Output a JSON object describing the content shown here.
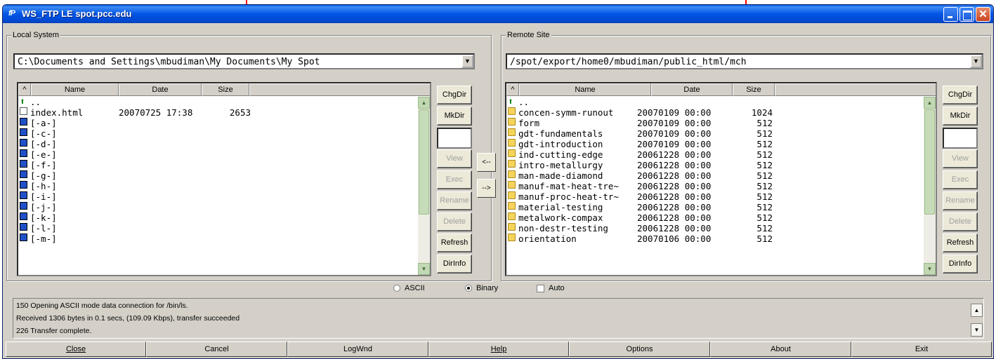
{
  "window": {
    "app_icon": "fP",
    "title": "WS_FTP LE spot.pcc.edu"
  },
  "local": {
    "group_label": "Local System",
    "path": "C:\\Documents and Settings\\mbudiman\\My Documents\\My Spot",
    "columns": [
      "^",
      "Name",
      "Date",
      "Size"
    ],
    "rows": [
      {
        "icon": "up-arrow-icon",
        "name": "..",
        "date": "",
        "size": ""
      },
      {
        "icon": "file-icon",
        "name": "index.html",
        "date": "20070725 17:38",
        "size": "2653"
      },
      {
        "icon": "drive-icon",
        "name": "[-a-]",
        "date": "",
        "size": ""
      },
      {
        "icon": "drive-icon",
        "name": "[-c-]",
        "date": "",
        "size": ""
      },
      {
        "icon": "drive-icon",
        "name": "[-d-]",
        "date": "",
        "size": ""
      },
      {
        "icon": "drive-icon",
        "name": "[-e-]",
        "date": "",
        "size": ""
      },
      {
        "icon": "drive-icon",
        "name": "[-f-]",
        "date": "",
        "size": ""
      },
      {
        "icon": "drive-icon",
        "name": "[-g-]",
        "date": "",
        "size": ""
      },
      {
        "icon": "drive-icon",
        "name": "[-h-]",
        "date": "",
        "size": ""
      },
      {
        "icon": "drive-icon",
        "name": "[-i-]",
        "date": "",
        "size": ""
      },
      {
        "icon": "drive-icon",
        "name": "[-j-]",
        "date": "",
        "size": ""
      },
      {
        "icon": "drive-icon",
        "name": "[-k-]",
        "date": "",
        "size": ""
      },
      {
        "icon": "drive-icon",
        "name": "[-l-]",
        "date": "",
        "size": ""
      },
      {
        "icon": "drive-icon",
        "name": "[-m-]",
        "date": "",
        "size": ""
      }
    ],
    "buttons": {
      "chgdir": "ChgDir",
      "mkdir": "MkDir",
      "view": "View",
      "exec": "Exec",
      "rename": "Rename",
      "delete": "Delete",
      "refresh": "Refresh",
      "dirinfo": "DirInfo"
    }
  },
  "remote": {
    "group_label": "Remote Site",
    "path": "/spot/export/home0/mbudiman/public_html/mch",
    "columns": [
      "^",
      "Name",
      "Date",
      "Size"
    ],
    "rows": [
      {
        "icon": "up-arrow-icon",
        "name": "..",
        "date": "",
        "size": ""
      },
      {
        "icon": "folder-icon",
        "name": "concen-symm-runout",
        "date": "20070109 00:00",
        "size": "1024"
      },
      {
        "icon": "folder-icon",
        "name": "form",
        "date": "20070109 00:00",
        "size": "512"
      },
      {
        "icon": "folder-icon",
        "name": "gdt-fundamentals",
        "date": "20070109 00:00",
        "size": "512"
      },
      {
        "icon": "folder-icon",
        "name": "gdt-introduction",
        "date": "20070109 00:00",
        "size": "512"
      },
      {
        "icon": "folder-icon",
        "name": "ind-cutting-edge",
        "date": "20061228 00:00",
        "size": "512"
      },
      {
        "icon": "folder-icon",
        "name": "intro-metallurgy",
        "date": "20061228 00:00",
        "size": "512"
      },
      {
        "icon": "folder-icon",
        "name": "man-made-diamond",
        "date": "20061228 00:00",
        "size": "512"
      },
      {
        "icon": "folder-icon",
        "name": "manuf-mat-heat-tre~",
        "date": "20061228 00:00",
        "size": "512"
      },
      {
        "icon": "folder-icon",
        "name": "manuf-proc-heat-tr~",
        "date": "20061228 00:00",
        "size": "512"
      },
      {
        "icon": "folder-icon",
        "name": "material-testing",
        "date": "20061228 00:00",
        "size": "512"
      },
      {
        "icon": "folder-icon",
        "name": "metalwork-compax",
        "date": "20061228 00:00",
        "size": "512"
      },
      {
        "icon": "folder-icon",
        "name": "non-destr-testing",
        "date": "20061228 00:00",
        "size": "512"
      },
      {
        "icon": "folder-icon",
        "name": "orientation",
        "date": "20070106 00:00",
        "size": "512"
      }
    ],
    "buttons": {
      "chgdir": "ChgDir",
      "mkdir": "MkDir",
      "view": "View",
      "exec": "Exec",
      "rename": "Rename",
      "delete": "Delete",
      "refresh": "Refresh",
      "dirinfo": "DirInfo"
    }
  },
  "transfer": {
    "upload": "<--",
    "download": "-->"
  },
  "mode": {
    "ascii": "ASCII",
    "binary": "Binary",
    "auto": "Auto",
    "selected": "Binary"
  },
  "log": [
    "150 Opening ASCII mode data connection for /bin/ls.",
    "Received 1306 bytes in 0.1 secs, (109.09 Kbps), transfer succeeded",
    "226 Transfer complete."
  ],
  "bottom_buttons": [
    {
      "key": "close",
      "label": "Close"
    },
    {
      "key": "cancel",
      "label": "Cancel"
    },
    {
      "key": "logwnd",
      "label": "LogWnd"
    },
    {
      "key": "help",
      "label": "Help"
    },
    {
      "key": "options",
      "label": "Options"
    },
    {
      "key": "about",
      "label": "About"
    },
    {
      "key": "exit",
      "label": "Exit"
    }
  ],
  "colors": {
    "titlebar": "#0055e5",
    "annotation": "#ff0000",
    "face": "#d4d0c8"
  }
}
